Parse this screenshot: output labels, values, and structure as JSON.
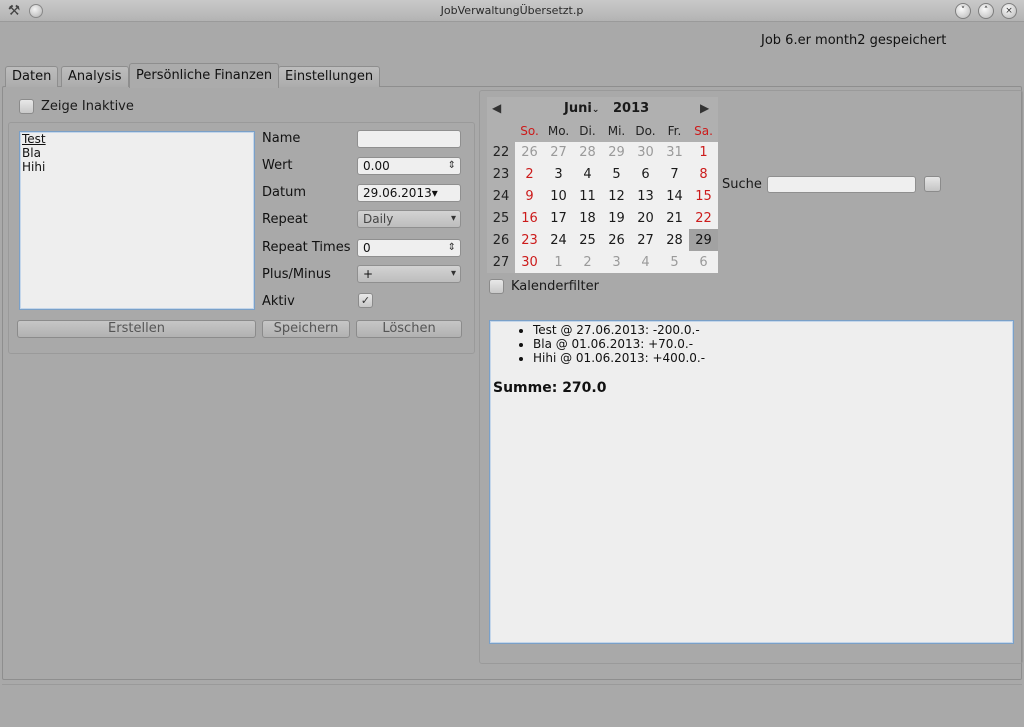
{
  "window": {
    "title": "JobVerwaltungÜbersetzt.p",
    "status_message": "Job 6.er month2 gespeichert",
    "buttons": [
      "˅",
      "˄",
      "×"
    ]
  },
  "tabs": [
    {
      "label": "Daten",
      "active": false
    },
    {
      "label": "Analysis",
      "active": false
    },
    {
      "label": "Persönliche Finanzen",
      "active": true
    },
    {
      "label": "Einstellungen",
      "active": false
    }
  ],
  "left": {
    "show_inactive_label": "Zeige Inaktive",
    "show_inactive_checked": false,
    "list_items": [
      "Test",
      "Bla",
      "Hihi"
    ],
    "form": {
      "name_label": "Name",
      "name_value": "",
      "wert_label": "Wert",
      "wert_value": "0.00",
      "datum_label": "Datum",
      "datum_value": "29.06.2013",
      "repeat_label": "Repeat",
      "repeat_value": "Daily",
      "repeat_times_label": "Repeat Times",
      "repeat_times_value": "0",
      "plus_minus_label": "Plus/Minus",
      "plus_minus_value": "+",
      "aktiv_label": "Aktiv",
      "aktiv_checked": true
    },
    "buttons": {
      "create": "Erstellen",
      "save": "Speichern",
      "delete": "Löschen"
    }
  },
  "calendar": {
    "month": "Juni",
    "year": "2013",
    "weekdays": [
      "So.",
      "Mo.",
      "Di.",
      "Mi.",
      "Do.",
      "Fr.",
      "Sa."
    ],
    "weeks": [
      {
        "wk": "22",
        "days": [
          "26",
          "27",
          "28",
          "29",
          "30",
          "31",
          "1"
        ]
      },
      {
        "wk": "23",
        "days": [
          "2",
          "3",
          "4",
          "5",
          "6",
          "7",
          "8"
        ]
      },
      {
        "wk": "24",
        "days": [
          "9",
          "10",
          "11",
          "12",
          "13",
          "14",
          "15"
        ]
      },
      {
        "wk": "25",
        "days": [
          "16",
          "17",
          "18",
          "19",
          "20",
          "21",
          "22"
        ]
      },
      {
        "wk": "26",
        "days": [
          "23",
          "24",
          "25",
          "26",
          "27",
          "28",
          "29"
        ]
      },
      {
        "wk": "27",
        "days": [
          "30",
          "1",
          "2",
          "3",
          "4",
          "5",
          "6"
        ]
      }
    ],
    "selected_day": "29",
    "filter_label": "Kalenderfilter",
    "filter_checked": false,
    "weekend_color": "#cc1b1b"
  },
  "search": {
    "label": "Suche",
    "value": ""
  },
  "output": {
    "entries": [
      "Test @ 27.06.2013: -200.0.-",
      "Bla @ 01.06.2013: +70.0.-",
      "Hihi @ 01.06.2013: +400.0.-"
    ],
    "sum_text": "Summe: 270.0"
  }
}
